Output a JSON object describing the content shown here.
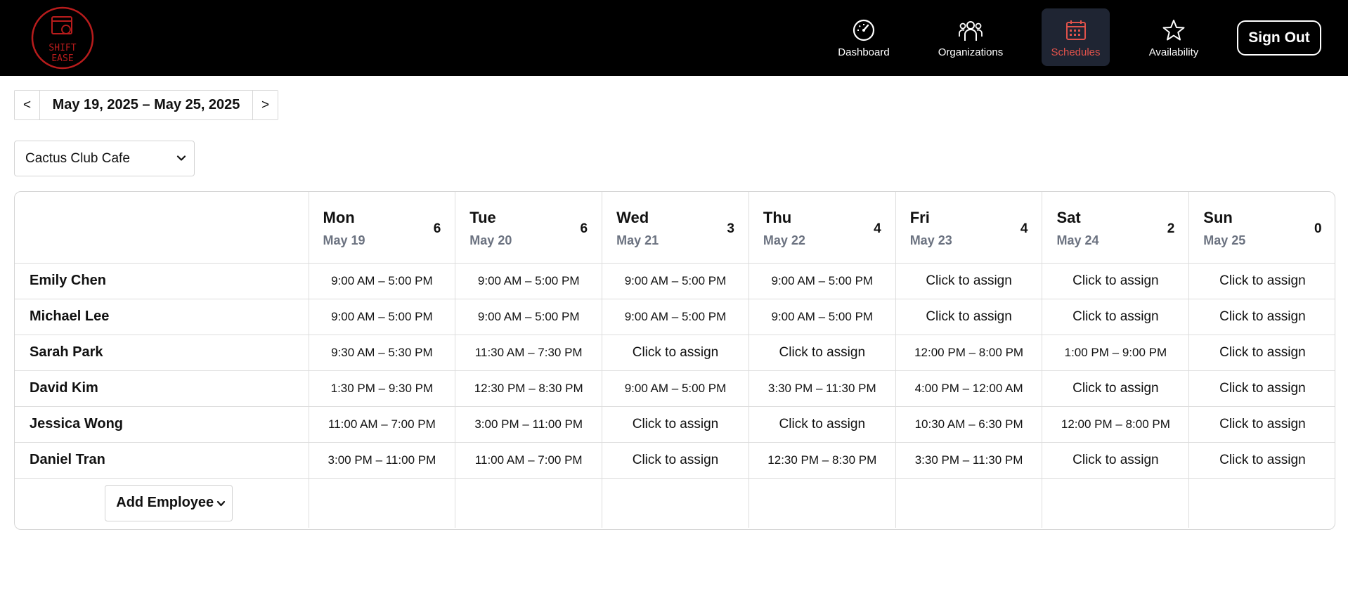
{
  "brand": {
    "logo_text": "SHIFT EASE",
    "accent_color": "#e0524b",
    "logo_color": "#b81c1c"
  },
  "nav": {
    "items": [
      {
        "label": "Dashboard",
        "icon": "dashboard-gauge-icon",
        "active": false
      },
      {
        "label": "Organizations",
        "icon": "users-group-icon",
        "active": false
      },
      {
        "label": "Schedules",
        "icon": "calendar-icon",
        "active": true
      },
      {
        "label": "Availability",
        "icon": "star-icon",
        "active": false
      }
    ],
    "sign_out_label": "Sign Out"
  },
  "week_picker": {
    "prev_label": "<",
    "next_label": ">",
    "range": "May 19, 2025 – May 25, 2025"
  },
  "org_select": {
    "selected": "Cactus Club Cafe",
    "icon": "chevron-down-icon"
  },
  "schedule": {
    "days": [
      {
        "name": "Mon",
        "date": "May 19",
        "count": "6"
      },
      {
        "name": "Tue",
        "date": "May 20",
        "count": "6"
      },
      {
        "name": "Wed",
        "date": "May 21",
        "count": "3"
      },
      {
        "name": "Thu",
        "date": "May 22",
        "count": "4"
      },
      {
        "name": "Fri",
        "date": "May 23",
        "count": "4"
      },
      {
        "name": "Sat",
        "date": "May 24",
        "count": "2"
      },
      {
        "name": "Sun",
        "date": "May 25",
        "count": "0"
      }
    ],
    "employees": [
      {
        "name": "Emily Chen",
        "shifts": [
          "9:00 AM – 5:00 PM",
          "9:00 AM – 5:00 PM",
          "9:00 AM – 5:00 PM",
          "9:00 AM – 5:00 PM",
          "Click to assign",
          "Click to assign",
          "Click to assign"
        ]
      },
      {
        "name": "Michael Lee",
        "shifts": [
          "9:00 AM – 5:00 PM",
          "9:00 AM – 5:00 PM",
          "9:00 AM – 5:00 PM",
          "9:00 AM – 5:00 PM",
          "Click to assign",
          "Click to assign",
          "Click to assign"
        ]
      },
      {
        "name": "Sarah Park",
        "shifts": [
          "9:30 AM – 5:30 PM",
          "11:30 AM – 7:30 PM",
          "Click to assign",
          "Click to assign",
          "12:00 PM – 8:00 PM",
          "1:00 PM – 9:00 PM",
          "Click to assign"
        ]
      },
      {
        "name": "David Kim",
        "shifts": [
          "1:30 PM – 9:30 PM",
          "12:30 PM – 8:30 PM",
          "9:00 AM – 5:00 PM",
          "3:30 PM – 11:30 PM",
          "4:00 PM – 12:00 AM",
          "Click to assign",
          "Click to assign"
        ]
      },
      {
        "name": "Jessica Wong",
        "shifts": [
          "11:00 AM – 7:00 PM",
          "3:00 PM – 11:00 PM",
          "Click to assign",
          "Click to assign",
          "10:30 AM – 6:30 PM",
          "12:00 PM – 8:00 PM",
          "Click to assign"
        ]
      },
      {
        "name": "Daniel Tran",
        "shifts": [
          "3:00 PM – 11:00 PM",
          "11:00 AM – 7:00 PM",
          "Click to assign",
          "12:30 PM – 8:30 PM",
          "3:30 PM – 11:30 PM",
          "Click to assign",
          "Click to assign"
        ]
      }
    ],
    "add_employee_label": "Add Employee"
  }
}
